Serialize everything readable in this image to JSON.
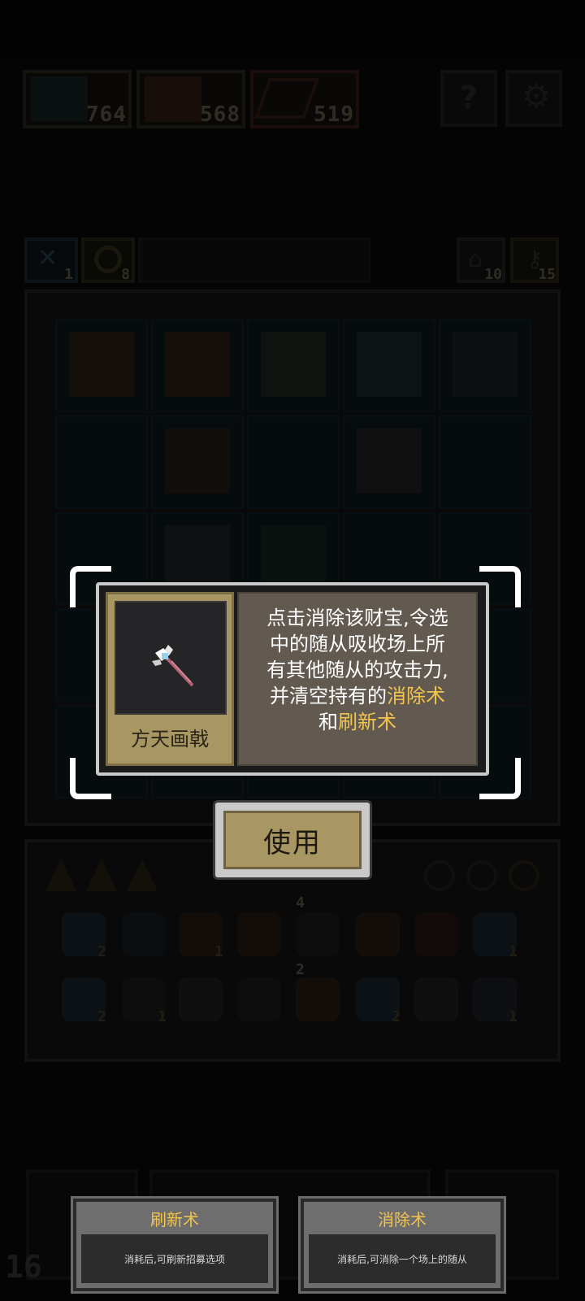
{
  "top_bar": {
    "resources": [
      {
        "icon": "hero-portrait-icon",
        "count": "764"
      },
      {
        "icon": "warrior-portrait-icon",
        "count": "568"
      },
      {
        "icon": "bow-icon",
        "count": "519"
      }
    ],
    "buttons": [
      {
        "icon": "question-icon"
      },
      {
        "icon": "settings-icon"
      }
    ]
  },
  "board_header": {
    "left": [
      {
        "icon": "sword-icon",
        "count": "1"
      },
      {
        "icon": "coin-icon",
        "count": "8"
      }
    ],
    "right": [
      {
        "icon": "house-icon",
        "count": "10"
      },
      {
        "icon": "key-icon",
        "count": "15"
      }
    ]
  },
  "tooltip": {
    "item_name": "方天画戟",
    "item_icon": "halberd-icon",
    "desc_lines": [
      [
        {
          "t": "点击消除该财宝,令选"
        }
      ],
      [
        {
          "t": "中的随从吸收场上所"
        }
      ],
      [
        {
          "t": "有其他随从的攻击力,"
        }
      ],
      [
        {
          "t": "并清空持有的"
        },
        {
          "t": "消除术",
          "hl": true
        }
      ],
      [
        {
          "t": "和"
        },
        {
          "t": "刷新术",
          "hl": true
        }
      ]
    ]
  },
  "use_button": {
    "label": "使用"
  },
  "inventory": {
    "row1_counts": [
      "2",
      "",
      "1",
      "",
      "4",
      "",
      "",
      "1"
    ],
    "row2_counts": [
      "2",
      "1",
      "",
      "",
      "2",
      "2",
      "",
      "1"
    ]
  },
  "bottom": {
    "counter": "16",
    "cards": [
      {
        "title": "刷新术",
        "desc": "消耗后,可刷新招募选项"
      },
      {
        "title": "消除术",
        "desc": "消耗后,可消除一个场上的随从"
      }
    ]
  },
  "colors": {
    "accent": "#f1c44e",
    "tooltip_bg": "#625a50",
    "card_tan": "#a89763"
  }
}
